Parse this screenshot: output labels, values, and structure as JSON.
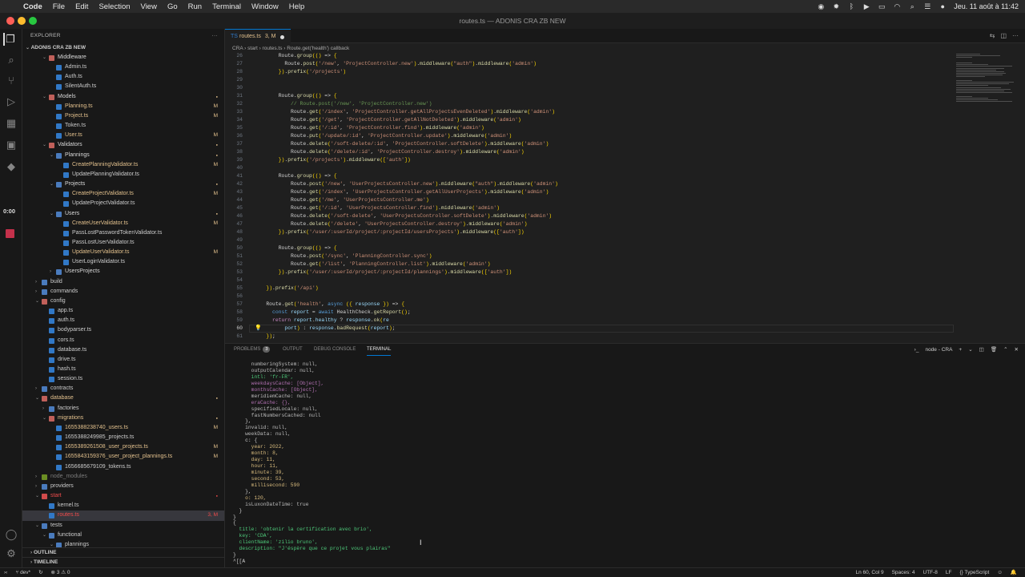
{
  "menubar": {
    "app": "Code",
    "items": [
      "File",
      "Edit",
      "Selection",
      "View",
      "Go",
      "Run",
      "Terminal",
      "Window",
      "Help"
    ],
    "clock": "Jeu. 11 août à 11:42"
  },
  "window": {
    "title": "routes.ts — ADONIS CRA ZB NEW"
  },
  "explorer": {
    "header": "EXPLORER",
    "project": "ADONIS CRA ZB NEW",
    "outline": "OUTLINE",
    "timeline": "TIMELINE",
    "rows": [
      {
        "label": "Middleware",
        "depth": 2,
        "type": "folder",
        "open": true,
        "color": "#d9d9d9",
        "status": ""
      },
      {
        "label": "Admin.ts",
        "depth": 3,
        "type": "ts",
        "color": "#cccccc",
        "status": ""
      },
      {
        "label": "Auth.ts",
        "depth": 3,
        "type": "ts",
        "color": "#cccccc",
        "status": ""
      },
      {
        "label": "SilentAuth.ts",
        "depth": 3,
        "type": "ts",
        "color": "#cccccc",
        "status": ""
      },
      {
        "label": "Models",
        "depth": 2,
        "type": "folder",
        "open": true,
        "color": "#d9d9d9",
        "status": "dot",
        "scolor": "#e2c08d"
      },
      {
        "label": "Planning.ts",
        "depth": 3,
        "type": "ts",
        "color": "#e2c08d",
        "status": "M",
        "scolor": "#e2c08d"
      },
      {
        "label": "Project.ts",
        "depth": 3,
        "type": "ts",
        "color": "#e2c08d",
        "status": "M",
        "scolor": "#e2c08d"
      },
      {
        "label": "Token.ts",
        "depth": 3,
        "type": "ts",
        "color": "#cccccc",
        "status": ""
      },
      {
        "label": "User.ts",
        "depth": 3,
        "type": "ts",
        "color": "#e2c08d",
        "status": "M",
        "scolor": "#e2c08d"
      },
      {
        "label": "Validators",
        "depth": 2,
        "type": "folder",
        "open": true,
        "color": "#d9d9d9",
        "status": "dot",
        "scolor": "#e2c08d"
      },
      {
        "label": "Plannings",
        "depth": 3,
        "type": "folder",
        "open": true,
        "color": "#d9d9d9",
        "status": "dot",
        "scolor": "#e2c08d"
      },
      {
        "label": "CreatePlanningValidator.ts",
        "depth": 4,
        "type": "ts",
        "color": "#e2c08d",
        "status": "M",
        "scolor": "#e2c08d"
      },
      {
        "label": "UpdatePlanningValidator.ts",
        "depth": 4,
        "type": "ts",
        "color": "#cccccc",
        "status": ""
      },
      {
        "label": "Projects",
        "depth": 3,
        "type": "folder",
        "open": true,
        "color": "#d9d9d9",
        "status": "dot",
        "scolor": "#e2c08d"
      },
      {
        "label": "CreateProjectValidator.ts",
        "depth": 4,
        "type": "ts",
        "color": "#e2c08d",
        "status": "M",
        "scolor": "#e2c08d"
      },
      {
        "label": "UpdateProjectValidator.ts",
        "depth": 4,
        "type": "ts",
        "color": "#cccccc",
        "status": ""
      },
      {
        "label": "Users",
        "depth": 3,
        "type": "folder",
        "open": true,
        "color": "#d9d9d9",
        "status": "dot",
        "scolor": "#e2c08d"
      },
      {
        "label": "CreateUserValidator.ts",
        "depth": 4,
        "type": "ts",
        "color": "#e2c08d",
        "status": "M",
        "scolor": "#e2c08d"
      },
      {
        "label": "PassLostPasswordTokenValidator.ts",
        "depth": 4,
        "type": "ts",
        "color": "#cccccc",
        "status": ""
      },
      {
        "label": "PassLostUserValidator.ts",
        "depth": 4,
        "type": "ts",
        "color": "#cccccc",
        "status": ""
      },
      {
        "label": "UpdateUserValidator.ts",
        "depth": 4,
        "type": "ts",
        "color": "#e2c08d",
        "status": "M",
        "scolor": "#e2c08d"
      },
      {
        "label": "UserLoginValidator.ts",
        "depth": 4,
        "type": "ts",
        "color": "#cccccc",
        "status": ""
      },
      {
        "label": "UsersProjects",
        "depth": 3,
        "type": "folder",
        "open": false,
        "color": "#d9d9d9",
        "status": ""
      },
      {
        "label": "build",
        "depth": 1,
        "type": "folder",
        "open": false,
        "color": "#cccccc",
        "status": ""
      },
      {
        "label": "commands",
        "depth": 1,
        "type": "folder",
        "open": false,
        "color": "#cccccc",
        "status": ""
      },
      {
        "label": "config",
        "depth": 1,
        "type": "folder",
        "open": true,
        "color": "#cccccc",
        "status": ""
      },
      {
        "label": "app.ts",
        "depth": 2,
        "type": "ts",
        "color": "#cccccc",
        "status": ""
      },
      {
        "label": "auth.ts",
        "depth": 2,
        "type": "ts",
        "color": "#cccccc",
        "status": ""
      },
      {
        "label": "bodyparser.ts",
        "depth": 2,
        "type": "ts",
        "color": "#cccccc",
        "status": ""
      },
      {
        "label": "cors.ts",
        "depth": 2,
        "type": "ts",
        "color": "#cccccc",
        "status": ""
      },
      {
        "label": "database.ts",
        "depth": 2,
        "type": "ts",
        "color": "#cccccc",
        "status": ""
      },
      {
        "label": "drive.ts",
        "depth": 2,
        "type": "ts",
        "color": "#cccccc",
        "status": ""
      },
      {
        "label": "hash.ts",
        "depth": 2,
        "type": "ts",
        "color": "#cccccc",
        "status": ""
      },
      {
        "label": "session.ts",
        "depth": 2,
        "type": "ts",
        "color": "#cccccc",
        "status": ""
      },
      {
        "label": "contracts",
        "depth": 1,
        "type": "folder",
        "open": false,
        "color": "#cccccc",
        "status": ""
      },
      {
        "label": "database",
        "depth": 1,
        "type": "folder",
        "open": true,
        "color": "#e2c08d",
        "status": "dot",
        "scolor": "#e2c08d"
      },
      {
        "label": "factories",
        "depth": 2,
        "type": "folder",
        "open": false,
        "color": "#cccccc",
        "status": ""
      },
      {
        "label": "migrations",
        "depth": 2,
        "type": "folder",
        "open": true,
        "color": "#e2c08d",
        "status": "dot",
        "scolor": "#e2c08d"
      },
      {
        "label": "1655388238740_users.ts",
        "depth": 3,
        "type": "ts",
        "color": "#e2c08d",
        "status": "M",
        "scolor": "#e2c08d"
      },
      {
        "label": "1655388249985_projects.ts",
        "depth": 3,
        "type": "ts",
        "color": "#cccccc",
        "status": ""
      },
      {
        "label": "1655389261508_user_projects.ts",
        "depth": 3,
        "type": "ts",
        "color": "#e2c08d",
        "status": "M",
        "scolor": "#e2c08d"
      },
      {
        "label": "1655843159376_user_project_plannings.ts",
        "depth": 3,
        "type": "ts",
        "color": "#e2c08d",
        "status": "M",
        "scolor": "#e2c08d"
      },
      {
        "label": "1656685679109_tokens.ts",
        "depth": 3,
        "type": "ts",
        "color": "#cccccc",
        "status": ""
      },
      {
        "label": "node_modules",
        "depth": 1,
        "type": "folder",
        "open": false,
        "color": "#7a7a7a",
        "status": ""
      },
      {
        "label": "providers",
        "depth": 1,
        "type": "folder",
        "open": false,
        "color": "#cccccc",
        "status": ""
      },
      {
        "label": "start",
        "depth": 1,
        "type": "folder",
        "open": true,
        "color": "#f14c4c",
        "status": "dot",
        "scolor": "#f14c4c"
      },
      {
        "label": "kernel.ts",
        "depth": 2,
        "type": "ts",
        "color": "#cccccc",
        "status": ""
      },
      {
        "label": "routes.ts",
        "depth": 2,
        "type": "ts",
        "color": "#f14c4c",
        "status": "3, M",
        "scolor": "#f14c4c",
        "selected": true
      },
      {
        "label": "tests",
        "depth": 1,
        "type": "folder",
        "open": true,
        "color": "#cccccc",
        "status": ""
      },
      {
        "label": "functional",
        "depth": 2,
        "type": "folder",
        "open": true,
        "color": "#cccccc",
        "status": ""
      },
      {
        "label": "plannings",
        "depth": 3,
        "type": "folder",
        "open": true,
        "color": "#cccccc",
        "status": ""
      }
    ]
  },
  "editor": {
    "tab": {
      "label": "routes.ts",
      "badge": "3, M"
    },
    "breadcrumb": "CRA  ›  start  ›  routes.ts  ›  Route.get('health') callback",
    "current_line": "60",
    "lines": [
      {
        "n": "26",
        "t": "        Route.group(() => {"
      },
      {
        "n": "27",
        "t": "          Route.post('/new', 'ProjectController.new').middleware(\"auth\").middleware('admin')"
      },
      {
        "n": "28",
        "t": "        }).prefix('/projects')"
      },
      {
        "n": "29",
        "t": ""
      },
      {
        "n": "30",
        "t": ""
      },
      {
        "n": "31",
        "t": "        Route.group(() => {"
      },
      {
        "n": "32",
        "t": "            // Route.post('/new', 'ProjectController.new')"
      },
      {
        "n": "33",
        "t": "            Route.get('/index', 'ProjectController.getAllProjectsEvenDeleted').middleware('admin')"
      },
      {
        "n": "34",
        "t": "            Route.get('/get', 'ProjectController.getAllNotDeleted').middleware('admin')"
      },
      {
        "n": "35",
        "t": "            Route.get('/:id', 'ProjectController.find').middleware('admin')"
      },
      {
        "n": "36",
        "t": "            Route.put('/update/:id', 'ProjectController.update').middleware('admin')"
      },
      {
        "n": "37",
        "t": "            Route.delete('/soft-delete/:id', 'ProjectController.softDelete').middleware('admin')"
      },
      {
        "n": "38",
        "t": "            Route.delete('/delete/:id', 'ProjectController.destroy').middleware('admin')"
      },
      {
        "n": "39",
        "t": "        }).prefix('/projects').middleware(['auth'])"
      },
      {
        "n": "40",
        "t": ""
      },
      {
        "n": "41",
        "t": "        Route.group(() => {"
      },
      {
        "n": "42",
        "t": "            Route.post('/new', 'UserProjectsController.new').middleware(\"auth\").middleware('admin')"
      },
      {
        "n": "43",
        "t": "            Route.get('/index', 'UserProjectsController.getAllUserProjects').middleware('admin')"
      },
      {
        "n": "44",
        "t": "            Route.get('/me', 'UserProjectsController.me')"
      },
      {
        "n": "45",
        "t": "            Route.get('/:id', 'UserProjectsController.find').middleware('admin')"
      },
      {
        "n": "46",
        "t": "            Route.delete('/soft-delete', 'UserProjectsController.softDelete').middleware('admin')"
      },
      {
        "n": "47",
        "t": "            Route.delete('/delete', 'UserProjectsController.destroy').middleware('admin')"
      },
      {
        "n": "48",
        "t": "        }).prefix('/user/:userId/project/:projectId/usersProjects').middleware(['auth'])"
      },
      {
        "n": "49",
        "t": ""
      },
      {
        "n": "50",
        "t": "        Route.group(() => {"
      },
      {
        "n": "51",
        "t": "            Route.post('/sync', 'PlanningController.sync')"
      },
      {
        "n": "52",
        "t": "            Route.get('/list', 'PlanningController.list').middleware('admin')"
      },
      {
        "n": "53",
        "t": "        }).prefix('/user/:userId/project/:projectId/plannings').middleware(['auth'])"
      },
      {
        "n": "54",
        "t": ""
      },
      {
        "n": "55",
        "t": "    }).prefix('/api')"
      },
      {
        "n": "56",
        "t": ""
      },
      {
        "n": "57",
        "t": "    Route.get('health', async ({ response }) => {"
      },
      {
        "n": "58",
        "t": "      const report = await HealthCheck.getReport();"
      },
      {
        "n": "59",
        "t": "      return report.healthy ? response.ok(re"
      },
      {
        "n": "60",
        "t": "          port) : response.badRequest(report);"
      },
      {
        "n": "61",
        "t": "    });"
      }
    ]
  },
  "panel": {
    "tabs": [
      "PROBLEMS",
      "OUTPUT",
      "DEBUG CONSOLE",
      "TERMINAL"
    ],
    "problems_count": "3",
    "active": "TERMINAL",
    "terminal_name": "node - CRA",
    "terminal_lines": [
      "      numberingSystem: null,",
      "      outputCalendar: null,",
      "      intl: 'fr-FR',",
      "      weekdaysCache: [Object],",
      "      monthsCache: [Object],",
      "      meridiemCache: null,",
      "      eraCache: {},",
      "      specifiedLocale: null,",
      "      fastNumbersCached: null",
      "    },",
      "    invalid: null,",
      "    weekData: null,",
      "    c: {",
      "      year: 2022,",
      "      month: 8,",
      "      day: 11,",
      "      hour: 11,",
      "      minute: 39,",
      "      second: 53,",
      "      millisecond: 590",
      "    },",
      "    o: 120,",
      "    isLuxonDateTime: true",
      "  }",
      "}",
      "{",
      "  title: 'obtenir la certification avec brio',",
      "  key: 'CDA',",
      "  clientName: 'zilio bruno',",
      "  description: \"J'éspère que ce projet vous plairas\"",
      "}",
      "^[[A"
    ]
  },
  "statusbar": {
    "branch": "dev*",
    "problems": "⊗ 3  ⚠ 0",
    "position": "Ln 60, Col 9",
    "spaces": "Spaces: 4",
    "encoding": "UTF-8",
    "eol": "LF",
    "language": "{} TypeScript"
  },
  "overlay": {
    "timer": "0:00"
  },
  "colors": {
    "accent": "#0078d4",
    "modified": "#e2c08d",
    "error": "#f14c4c"
  }
}
